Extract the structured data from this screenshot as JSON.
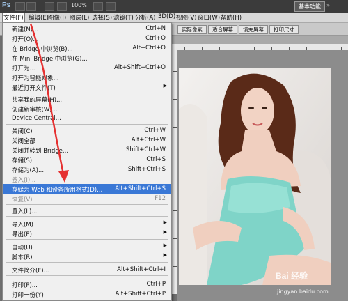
{
  "app": {
    "logo": "Ps",
    "zoom": "100%",
    "workspace": "基本功能"
  },
  "menubar": {
    "items": [
      {
        "label": "文件(F)"
      },
      {
        "label": "编辑(E)"
      },
      {
        "label": "图像(I)"
      },
      {
        "label": "图层(L)"
      },
      {
        "label": "选择(S)"
      },
      {
        "label": "滤镜(T)"
      },
      {
        "label": "分析(A)"
      },
      {
        "label": "3D(D)"
      },
      {
        "label": "视图(V)"
      },
      {
        "label": "窗口(W)"
      },
      {
        "label": "帮助(H)"
      }
    ]
  },
  "options": {
    "actual_pixels": "实际像素",
    "fit_screen": "适合屏幕",
    "fill_screen": "填充屏幕",
    "print_size": "打印尺寸"
  },
  "file_menu": {
    "items": [
      {
        "label": "新建(N)...",
        "shortcut": "Ctrl+N"
      },
      {
        "label": "打开(O)...",
        "shortcut": "Ctrl+O"
      },
      {
        "label": "在 Bridge 中浏览(B)...",
        "shortcut": "Alt+Ctrl+O"
      },
      {
        "label": "在 Mini Bridge 中浏览(G)...",
        "shortcut": ""
      },
      {
        "label": "打开为...",
        "shortcut": "Alt+Shift+Ctrl+O"
      },
      {
        "label": "打开为智能对象...",
        "shortcut": ""
      },
      {
        "label": "最近打开文件(T)",
        "shortcut": ""
      },
      {
        "label": "共享我的屏幕(H)...",
        "shortcut": ""
      },
      {
        "label": "创建新审核(W)...",
        "shortcut": ""
      },
      {
        "label": "Device Central...",
        "shortcut": ""
      },
      {
        "label": "关闭(C)",
        "shortcut": "Ctrl+W"
      },
      {
        "label": "关闭全部",
        "shortcut": "Alt+Ctrl+W"
      },
      {
        "label": "关闭并转到 Bridge...",
        "shortcut": "Shift+Ctrl+W"
      },
      {
        "label": "存储(S)",
        "shortcut": "Ctrl+S"
      },
      {
        "label": "存储为(A)...",
        "shortcut": "Shift+Ctrl+S"
      },
      {
        "label": "签入(I)...",
        "shortcut": ""
      },
      {
        "label": "存储为 Web 和设备所用格式(D)...",
        "shortcut": "Alt+Shift+Ctrl+S"
      },
      {
        "label": "恢复(V)",
        "shortcut": "F12"
      },
      {
        "label": "置入(L)...",
        "shortcut": ""
      },
      {
        "label": "导入(M)",
        "shortcut": ""
      },
      {
        "label": "导出(E)",
        "shortcut": ""
      },
      {
        "label": "自动(U)",
        "shortcut": ""
      },
      {
        "label": "脚本(R)",
        "shortcut": ""
      },
      {
        "label": "文件简介(F)...",
        "shortcut": "Alt+Shift+Ctrl+I"
      },
      {
        "label": "打印(P)...",
        "shortcut": "Ctrl+P"
      },
      {
        "label": "打印一份(Y)",
        "shortcut": "Alt+Shift+Ctrl+P"
      }
    ]
  },
  "watermark": {
    "text": "Bai 经验",
    "url": "jingyan.baidu.com"
  },
  "colors": {
    "highlight": "#3a78d6",
    "arrow": "#e53030",
    "dress": "#7fd4c8"
  }
}
